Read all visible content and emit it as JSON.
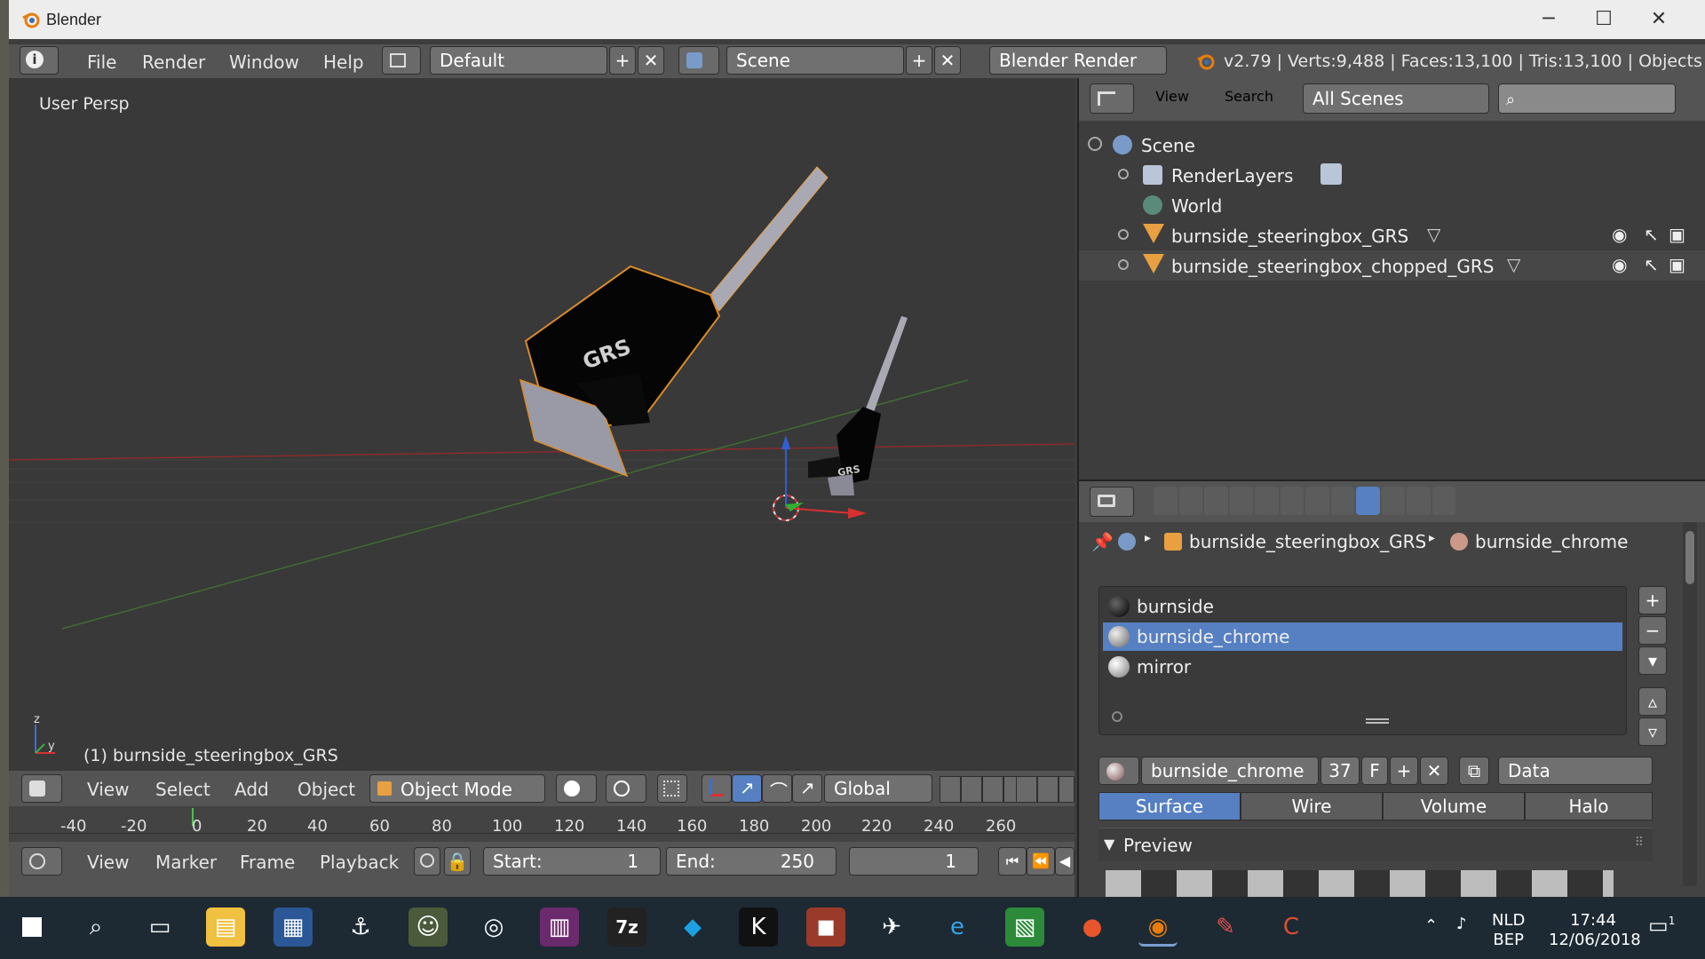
{
  "window": {
    "title": "Blender",
    "minimize": "─",
    "maximize": "☐",
    "close": "✕"
  },
  "menubar": {
    "items": [
      "File",
      "Render",
      "Window",
      "Help"
    ],
    "layout": "Default",
    "scene": "Scene",
    "engine": "Blender Render",
    "stats": "v2.79 | Verts:9,488 | Faces:13,100 | Tris:13,100 | Objects"
  },
  "viewport": {
    "label": "User Persp",
    "active_object": "(1) burnside_steeringbox_GRS",
    "model_text_large": "GRS",
    "model_text_small": "GRS",
    "axis_z": "z",
    "axis_y": "y"
  },
  "outliner": {
    "menus": [
      "View",
      "Search"
    ],
    "filter": "All Scenes",
    "rows": [
      {
        "label": "Scene",
        "icon": "scene-icon"
      },
      {
        "label": "RenderLayers",
        "icon": "renderlayers-icon"
      },
      {
        "label": "World",
        "icon": "world-icon"
      },
      {
        "label": "burnside_steeringbox_GRS",
        "icon": "mesh-object-icon"
      },
      {
        "label": "burnside_steeringbox_chopped_GRS",
        "icon": "mesh-object-icon"
      }
    ]
  },
  "properties": {
    "breadcrumb_object": "burnside_steeringbox_GRS",
    "breadcrumb_material": "burnside_chrome",
    "materials": [
      {
        "name": "burnside",
        "color": "#111111"
      },
      {
        "name": "burnside_chrome",
        "color": "#9a9a9a",
        "selected": true
      },
      {
        "name": "mirror",
        "color": "#a8a8a8"
      }
    ],
    "material_name": "burnside_chrome",
    "users": "37",
    "fake_user": "F",
    "link": "Data",
    "tabs": [
      "Surface",
      "Wire",
      "Volume",
      "Halo"
    ],
    "active_tab": "Surface",
    "panel_preview": "Preview"
  },
  "view3d_header": {
    "menus": [
      "View",
      "Select",
      "Add",
      "Object"
    ],
    "mode": "Object Mode",
    "orientation": "Global"
  },
  "timeline": {
    "ticks": [
      "-40",
      "-20",
      "0",
      "20",
      "40",
      "60",
      "80",
      "100",
      "120",
      "140",
      "160",
      "180",
      "200",
      "220",
      "240",
      "260"
    ],
    "menus": [
      "View",
      "Marker",
      "Frame",
      "Playback"
    ],
    "start_label": "Start:",
    "start": "1",
    "end_label": "End:",
    "end": "250",
    "current": "1"
  },
  "taskbar": {
    "lang1": "NLD",
    "lang2": "BEP",
    "time": "17:44",
    "date": "12/06/2018",
    "notifications": "1",
    "sevenzip": "7z"
  },
  "colors": {
    "selection": "#5680c2",
    "blender_orange": "#e87d0d",
    "header": "#545454"
  }
}
